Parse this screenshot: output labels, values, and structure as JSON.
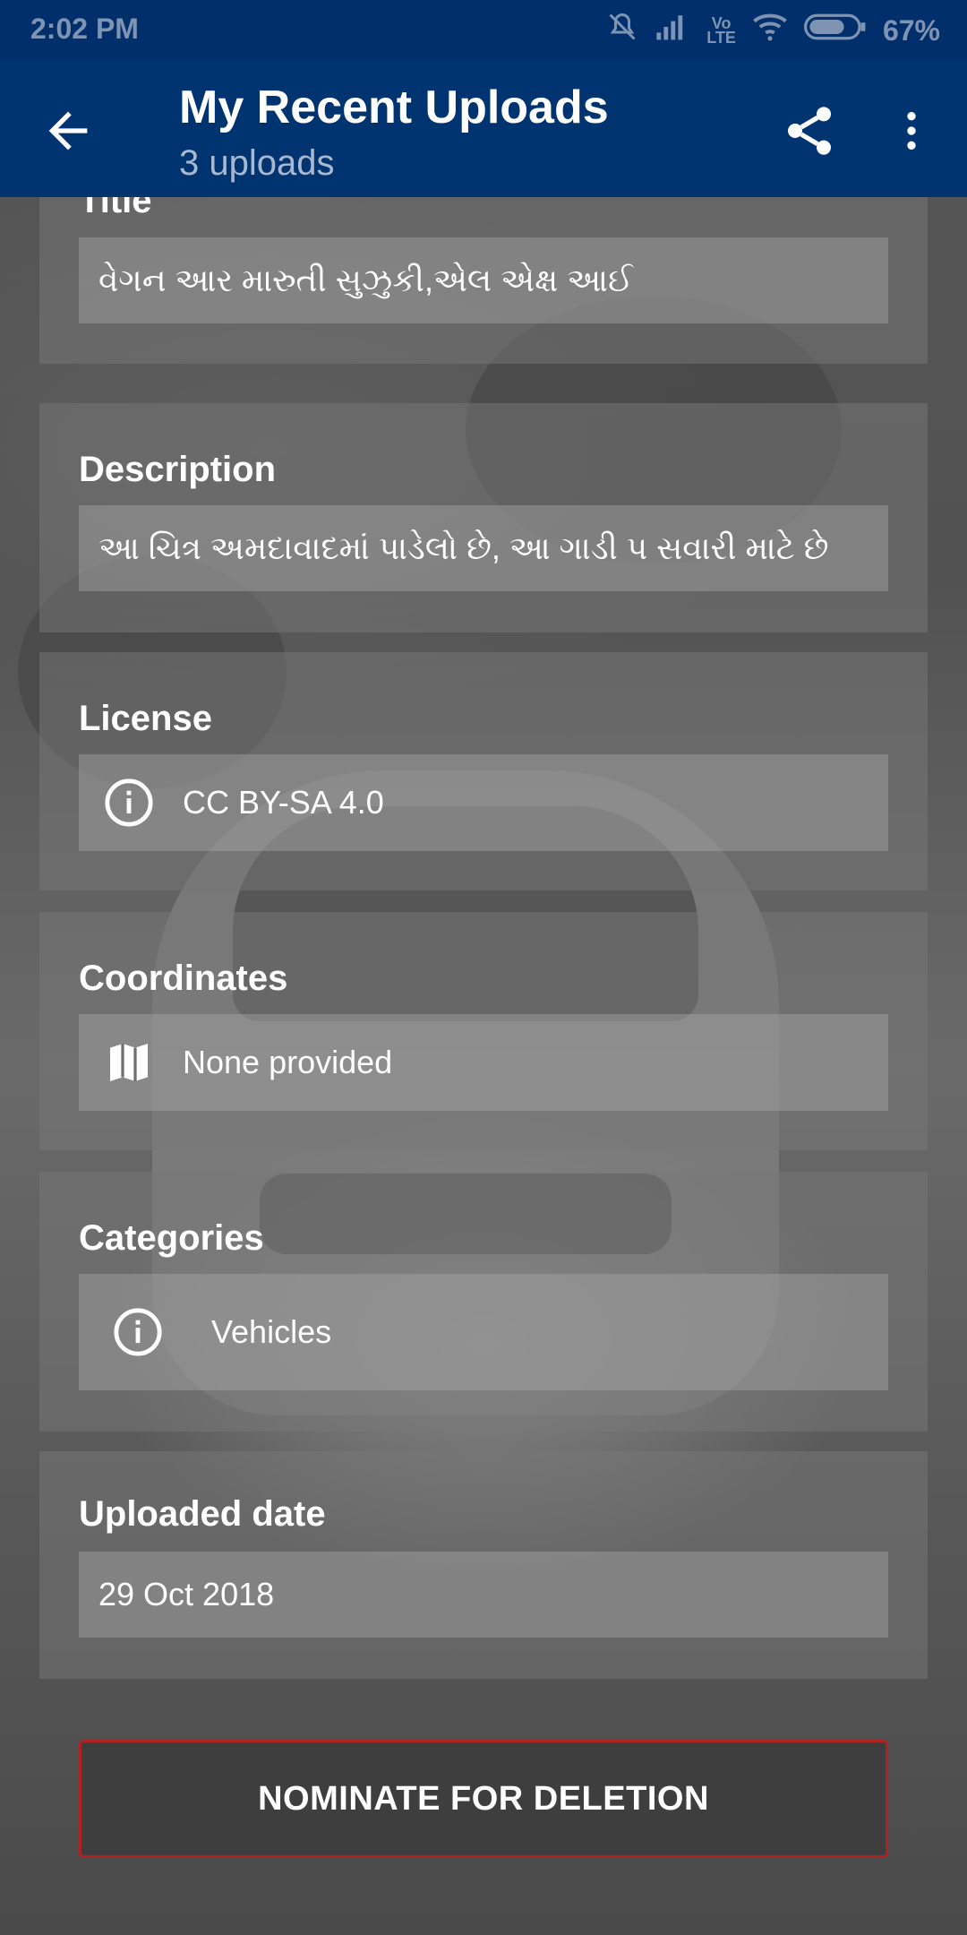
{
  "status_bar": {
    "time": "2:02 PM",
    "battery_percent": "67%",
    "icons": [
      "mute-icon",
      "signal-icon",
      "volte-icon",
      "wifi-icon",
      "battery-icon"
    ]
  },
  "app_bar": {
    "title": "My Recent Uploads",
    "subtitle": "3 uploads",
    "back_icon": "arrow-back-icon",
    "share_icon": "share-icon",
    "more_icon": "more-vert-icon"
  },
  "sections": {
    "title": {
      "label": "Title",
      "value": "વેગન આર મારુતી સુઝુકી,એલ એક્ષ આઈ"
    },
    "description": {
      "label": "Description",
      "value": "આ ચિત્ર અમદાવાદમાં પાડેલો છે, આ ગાડી પ સવારી માટે છે"
    },
    "license": {
      "label": "License",
      "value": "CC BY-SA 4.0",
      "icon": "info-icon"
    },
    "coordinates": {
      "label": "Coordinates",
      "value": "None provided",
      "icon": "map-icon"
    },
    "categories": {
      "label": "Categories",
      "value": "Vehicles",
      "icon": "info-icon"
    },
    "uploaded_date": {
      "label": "Uploaded date",
      "value": "29 Oct 2018"
    }
  },
  "actions": {
    "nominate_label": "NOMINATE FOR DELETION",
    "nominate_border_color": "#b02121"
  },
  "colors": {
    "app_bar": "#003470",
    "status_bar": "#002f6b"
  }
}
